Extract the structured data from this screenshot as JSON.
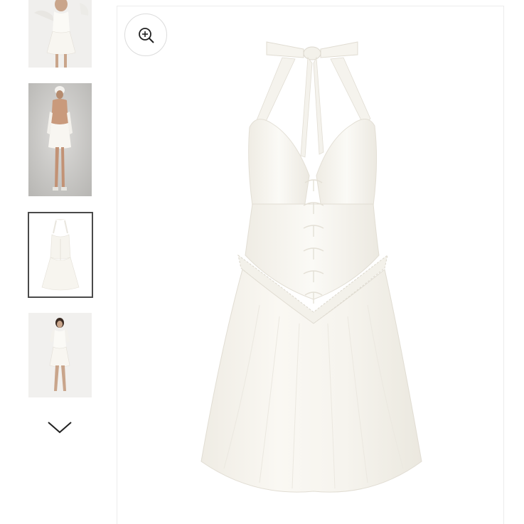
{
  "gallery": {
    "thumbnails": [
      {
        "icon": "model-front-photo",
        "selected": false
      },
      {
        "icon": "model-back-photo",
        "selected": false
      },
      {
        "icon": "dress-flat-photo",
        "selected": true
      },
      {
        "icon": "model-full-photo",
        "selected": false
      }
    ],
    "scroll_down_icon": "chevron-down-icon"
  },
  "main_image": {
    "icon": "white-halter-dress-photo",
    "zoom_icon": "zoom-in-icon"
  },
  "colors": {
    "selected_border": "#4a4a4a",
    "dress": "#f7f5ef",
    "panel_border": "#ececec"
  }
}
